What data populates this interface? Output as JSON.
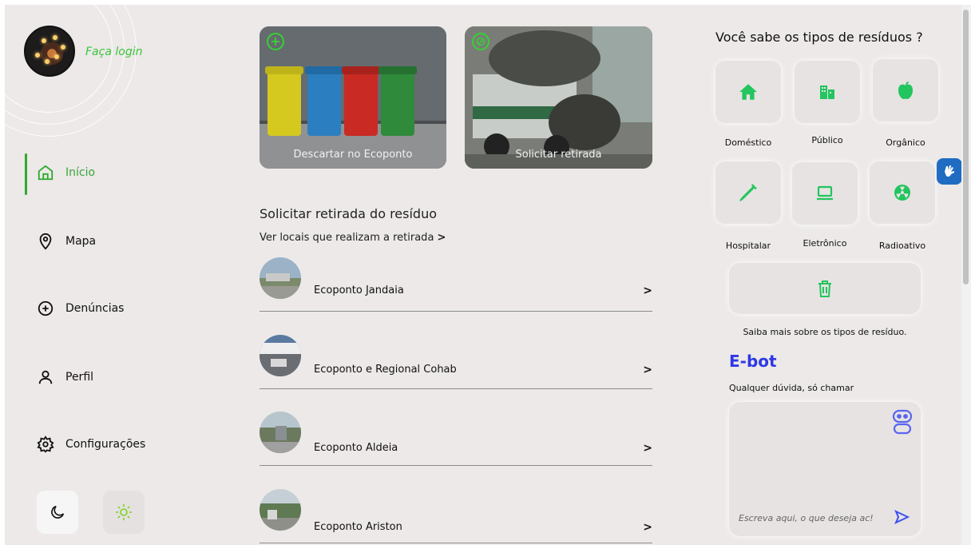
{
  "sidebar": {
    "login_label": "Faça login",
    "nav": [
      {
        "label": "Início",
        "icon": "home-icon",
        "active": true
      },
      {
        "label": "Mapa",
        "icon": "map-pin-icon",
        "active": false
      },
      {
        "label": "Denúncias",
        "icon": "plus-circle-icon",
        "active": false
      },
      {
        "label": "Perfil",
        "icon": "user-icon",
        "active": false
      },
      {
        "label": "Configurações",
        "icon": "gear-icon",
        "active": false
      }
    ],
    "modes": [
      {
        "icon": "moon-icon"
      },
      {
        "icon": "sun-icon"
      }
    ]
  },
  "cards": [
    {
      "label": "Descartar no Ecoponto",
      "icon": "plus-circle-icon"
    },
    {
      "label": "Solicitar retirada",
      "icon": "truck-icon"
    }
  ],
  "main": {
    "section_title": "Solicitar retirada do resíduo",
    "see_locations": "Ver locais que realizam a retirada",
    "ecopontos": [
      {
        "name": "Ecoponto Jandaia"
      },
      {
        "name": "Ecoponto e Regional Cohab"
      },
      {
        "name": "Ecoponto Aldeia"
      },
      {
        "name": "Ecoponto Ariston"
      }
    ]
  },
  "waste_types": {
    "title": "Você sabe os tipos de resíduos ?",
    "items": [
      {
        "label": "Doméstico",
        "icon": "house-icon"
      },
      {
        "label": "Público",
        "icon": "buildings-icon"
      },
      {
        "label": "Orgânico",
        "icon": "apple-icon"
      },
      {
        "label": "Hospitalar",
        "icon": "syringe-icon"
      },
      {
        "label": "Eletrônico",
        "icon": "laptop-icon"
      },
      {
        "label": "Radioativo",
        "icon": "radiation-icon"
      }
    ],
    "learn_more": "Saiba mais sobre os tipos de resíduo."
  },
  "ebot": {
    "title": "E-bot",
    "subtitle": "Qualquer dúvida, só chamar",
    "placeholder": "Escreva aqui, o que deseja ac!"
  },
  "colors": {
    "accent_green": "#2eaa2e",
    "bot_blue": "#2f38e6",
    "background": "#ece9e8"
  }
}
